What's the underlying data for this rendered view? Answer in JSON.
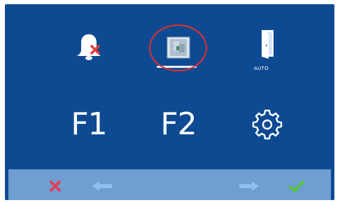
{
  "screen": {
    "background_color": "#0e4a92",
    "accent_ring_color": "#e0302d",
    "bottom_bar_color": "#6f9ed1"
  },
  "menu": {
    "row1": [
      {
        "name": "alarm-bell",
        "icon": "bell-with-x-icon"
      },
      {
        "name": "monitor-image",
        "icon": "image-icon",
        "selected": true
      },
      {
        "name": "door-auto",
        "icon": "door-icon",
        "caption": "AUTO"
      }
    ],
    "row2": [
      {
        "name": "f1",
        "label": "F1"
      },
      {
        "name": "f2",
        "label": "F2"
      },
      {
        "name": "settings",
        "icon": "gear-icon"
      }
    ]
  },
  "bottom_bar": {
    "cancel_icon": "x-icon",
    "left_icon": "arrow-left-icon",
    "right_icon": "arrow-right-icon",
    "confirm_icon": "check-icon"
  }
}
